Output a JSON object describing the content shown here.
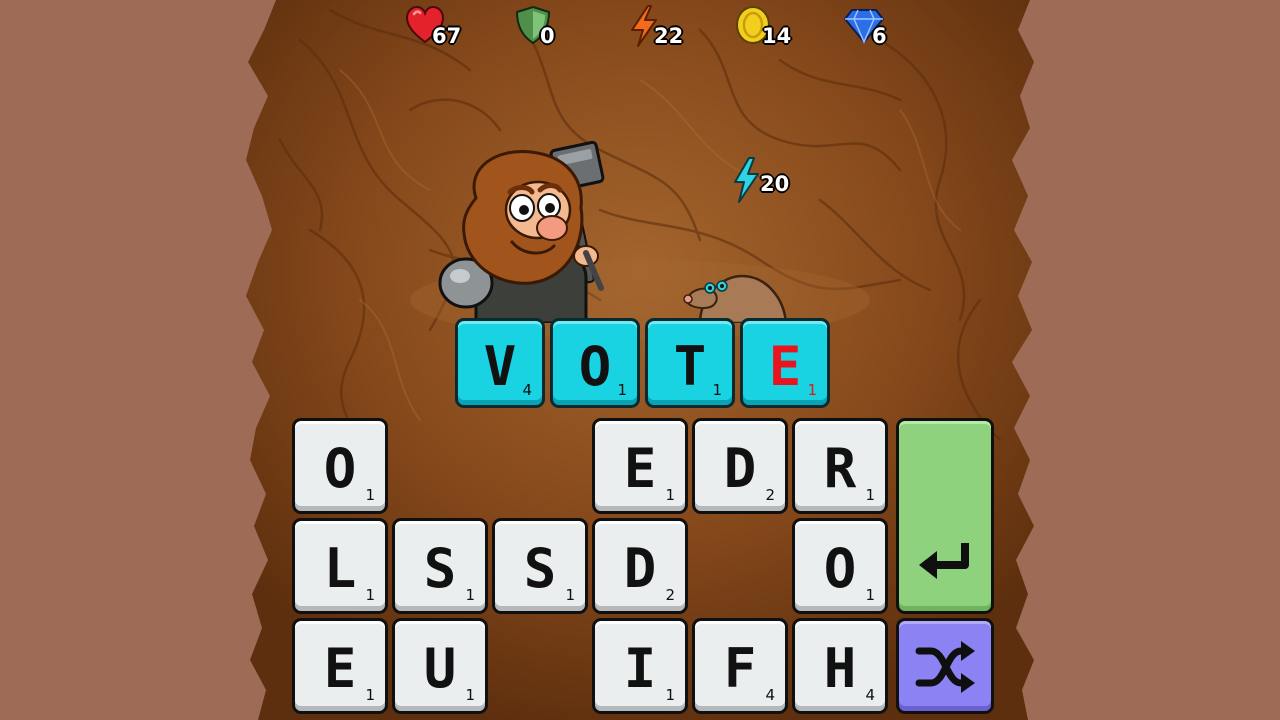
{
  "stats": {
    "health": "67",
    "armor": "0",
    "energy": "22",
    "coins": "14",
    "gems": "6"
  },
  "enemy": {
    "attack": "20"
  },
  "word": [
    {
      "letter": "V",
      "points": "4",
      "highlight": false
    },
    {
      "letter": "O",
      "points": "1",
      "highlight": false
    },
    {
      "letter": "T",
      "points": "1",
      "highlight": false
    },
    {
      "letter": "E",
      "points": "1",
      "highlight": true
    }
  ],
  "grid": [
    [
      {
        "letter": "O",
        "points": "1"
      },
      null,
      null,
      {
        "letter": "E",
        "points": "1"
      },
      {
        "letter": "D",
        "points": "2"
      },
      {
        "letter": "R",
        "points": "1"
      }
    ],
    [
      {
        "letter": "L",
        "points": "1"
      },
      {
        "letter": "S",
        "points": "1"
      },
      {
        "letter": "S",
        "points": "1"
      },
      {
        "letter": "D",
        "points": "2"
      },
      null,
      {
        "letter": "O",
        "points": "1"
      }
    ],
    [
      {
        "letter": "E",
        "points": "1"
      },
      {
        "letter": "U",
        "points": "1"
      },
      null,
      {
        "letter": "I",
        "points": "1"
      },
      {
        "letter": "F",
        "points": "4"
      },
      {
        "letter": "H",
        "points": "4"
      }
    ]
  ],
  "buttons": {
    "submit_icon": "enter-arrow-icon",
    "shuffle_icon": "shuffle-icon"
  },
  "colors": {
    "side_background": "#9e6b57",
    "cave": "#8a4e1e",
    "word_tile": "#19d2e2",
    "letter_tile": "#ebeeef",
    "submit": "#8fd27e",
    "shuffle": "#8b82f3",
    "highlight_letter": "#e8141e"
  }
}
